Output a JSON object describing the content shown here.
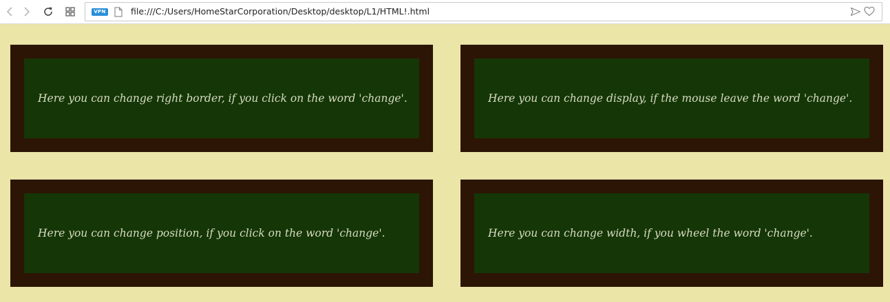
{
  "browser": {
    "vpn_label": "VPN",
    "url": "file:///C:/Users/HomeStarCorporation/Desktop/desktop/L1/HTML!.html",
    "icons": [
      "back-arrow-icon",
      "forward-arrow-icon",
      "reload-icon",
      "tiles-grid-icon",
      "page-icon",
      "send-icon",
      "heart-icon"
    ]
  },
  "cards": [
    {
      "text": "Here you can change right border, if you click on the word 'change'."
    },
    {
      "text": "Here you can change display, if the mouse leave the word 'change'."
    },
    {
      "text": "Here you can change position, if you click on the word 'change'."
    },
    {
      "text": "Here you can change width, if you wheel the word 'change'."
    }
  ],
  "colors": {
    "page_background": "#ebe5a8",
    "card_border": "#2c1505",
    "card_fill": "#153606",
    "card_text": "#d7dcc2",
    "vpn_badge": "#2b8fd8"
  }
}
